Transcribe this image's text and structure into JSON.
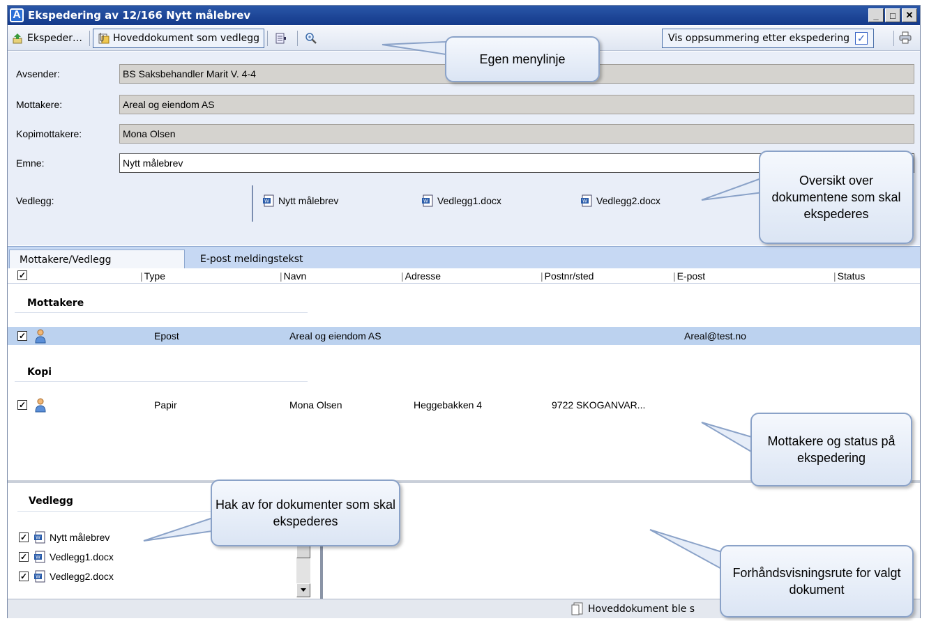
{
  "window": {
    "title": "Ekspedering av 12/166 Nytt målebrev",
    "app_icon_letter": "A",
    "controls": {
      "minimize": "_",
      "maximize": "□",
      "close": "✕"
    }
  },
  "toolbar": {
    "ekspeder_label": "Ekspeder…",
    "hoveddokument_label": "Hoveddokument som vedlegg",
    "vis_oppsummering_label": "Vis oppsummering etter ekspedering",
    "vis_oppsummering_checked": "✓"
  },
  "form": {
    "avsender_label": "Avsender:",
    "avsender_value": "BS Saksbehandler Marit V.  4-4",
    "mottakere_label": "Mottakere:",
    "mottakere_value": "Areal og eiendom AS",
    "kopimottakere_label": "Kopimottakere:",
    "kopimottakere_value": "Mona Olsen",
    "emne_label": "Emne:",
    "emne_value": "Nytt målebrev",
    "vedlegg_label": "Vedlegg:",
    "vedlegg_docs": [
      "Nytt målebrev",
      "Vedlegg1.docx",
      "Vedlegg2.docx"
    ]
  },
  "tabs": {
    "active": "Mottakere/Vedlegg",
    "inactive": "E-post meldingstekst"
  },
  "table": {
    "header_check": "✓",
    "columns": [
      "Type",
      "Navn",
      "Adresse",
      "Postnr/sted",
      "E-post",
      "Status"
    ],
    "group_mottakere": "Mottakere",
    "group_kopi": "Kopi",
    "row1": {
      "check": "✓",
      "type": "Epost",
      "navn": "Areal og eiendom AS",
      "adresse": "",
      "postnr": "",
      "epost": "Areal@test.no",
      "status": ""
    },
    "row2": {
      "check": "✓",
      "type": "Papir",
      "navn": "Mona Olsen",
      "adresse": "Heggebakken 4",
      "postnr": "9722 SKOGANVAR...",
      "epost": "",
      "status": ""
    }
  },
  "attachments": {
    "title": "Vedlegg",
    "items": [
      {
        "check": "✓",
        "name": "Nytt målebrev"
      },
      {
        "check": "✓",
        "name": "Vedlegg1.docx"
      },
      {
        "check": "✓",
        "name": "Vedlegg2.docx"
      }
    ]
  },
  "statusbar": {
    "text": "Hoveddokument ble s"
  },
  "callouts": {
    "menylinje": "Egen menylinje",
    "oversikt": "Oversikt over dokumentene som skal ekspederes",
    "mottakere_status": "Mottakere og status på ekspedering",
    "hak_av": "Hak av for dokumenter som skal ekspederes",
    "forhandsvisning": "Forhåndsvisningsrute for valgt dokument"
  },
  "colors": {
    "titlebar": "#14398a",
    "form_background": "#e9eef8",
    "tab_bar": "#c6d8f3",
    "selected_row": "#bcd2ef",
    "callout_border": "#8aa2c8"
  }
}
